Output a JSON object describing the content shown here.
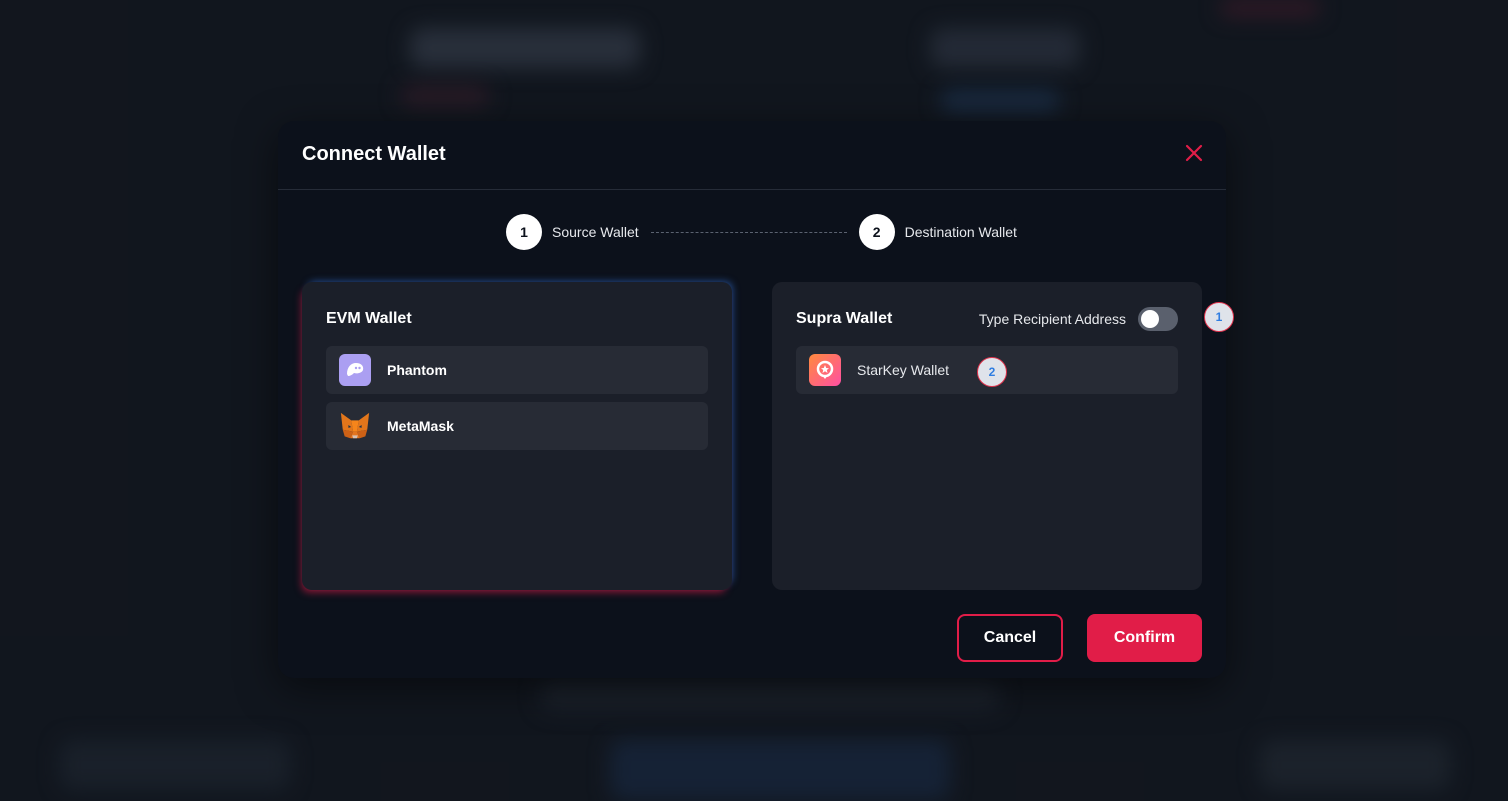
{
  "modal": {
    "title": "Connect Wallet"
  },
  "stepper": {
    "steps": [
      {
        "number": "1",
        "label": "Source Wallet"
      },
      {
        "number": "2",
        "label": "Destination Wallet"
      }
    ]
  },
  "left_panel": {
    "title": "EVM Wallet",
    "wallets": [
      {
        "name": "Phantom",
        "icon": "phantom-icon"
      },
      {
        "name": "MetaMask",
        "icon": "metamask-icon"
      }
    ]
  },
  "right_panel": {
    "title": "Supra Wallet",
    "toggle_label": "Type Recipient Address",
    "toggle_on": false,
    "wallets": [
      {
        "name": "StarKey Wallet",
        "icon": "starkey-icon"
      }
    ]
  },
  "markers": [
    "1",
    "2"
  ],
  "footer": {
    "cancel_label": "Cancel",
    "confirm_label": "Confirm"
  },
  "colors": {
    "accent": "#e11d48",
    "modal_bg": "#0c111b",
    "panel_bg": "#1b1f29",
    "row_bg": "#272b35"
  }
}
